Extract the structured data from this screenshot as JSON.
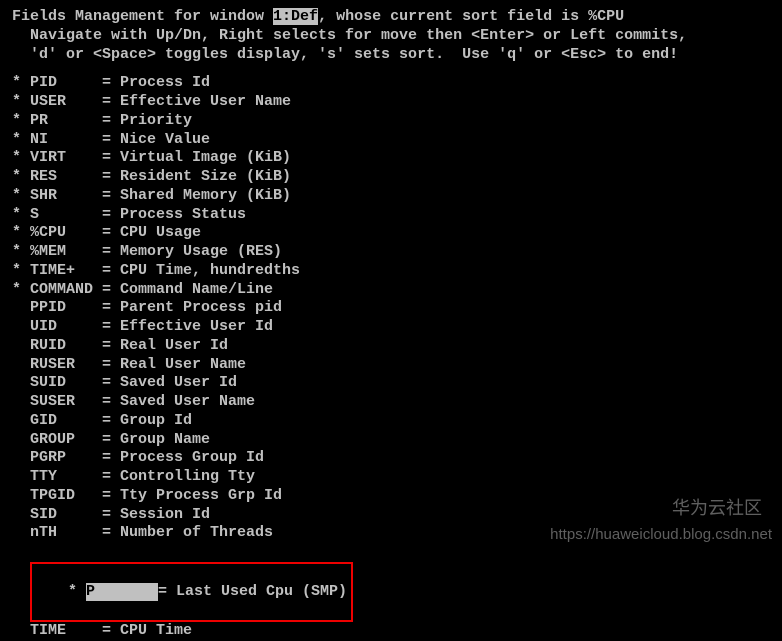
{
  "header": {
    "pre1": "Fields Management for window ",
    "win": "1:Def",
    "post1": ", whose current sort field is %CPU",
    "line2": "Navigate with Up/Dn, Right selects for move then <Enter> or Left commits,",
    "line3": "'d' or <Space> toggles display, 's' sets sort.  Use 'q' or <Esc> to end!"
  },
  "fields": [
    {
      "on": true,
      "name": "PID",
      "desc": "Process Id"
    },
    {
      "on": true,
      "name": "USER",
      "desc": "Effective User Name"
    },
    {
      "on": true,
      "name": "PR",
      "desc": "Priority"
    },
    {
      "on": true,
      "name": "NI",
      "desc": "Nice Value"
    },
    {
      "on": true,
      "name": "VIRT",
      "desc": "Virtual Image (KiB)"
    },
    {
      "on": true,
      "name": "RES",
      "desc": "Resident Size (KiB)"
    },
    {
      "on": true,
      "name": "SHR",
      "desc": "Shared Memory (KiB)"
    },
    {
      "on": true,
      "name": "S",
      "desc": "Process Status"
    },
    {
      "on": true,
      "name": "%CPU",
      "desc": "CPU Usage"
    },
    {
      "on": true,
      "name": "%MEM",
      "desc": "Memory Usage (RES)"
    },
    {
      "on": true,
      "name": "TIME+",
      "desc": "CPU Time, hundredths"
    },
    {
      "on": true,
      "name": "COMMAND",
      "desc": "Command Name/Line"
    },
    {
      "on": false,
      "name": "PPID",
      "desc": "Parent Process pid"
    },
    {
      "on": false,
      "name": "UID",
      "desc": "Effective User Id"
    },
    {
      "on": false,
      "name": "RUID",
      "desc": "Real User Id"
    },
    {
      "on": false,
      "name": "RUSER",
      "desc": "Real User Name"
    },
    {
      "on": false,
      "name": "SUID",
      "desc": "Saved User Id"
    },
    {
      "on": false,
      "name": "SUSER",
      "desc": "Saved User Name"
    },
    {
      "on": false,
      "name": "GID",
      "desc": "Group Id"
    },
    {
      "on": false,
      "name": "GROUP",
      "desc": "Group Name"
    },
    {
      "on": false,
      "name": "PGRP",
      "desc": "Process Group Id"
    },
    {
      "on": false,
      "name": "TTY",
      "desc": "Controlling Tty"
    },
    {
      "on": false,
      "name": "TPGID",
      "desc": "Tty Process Grp Id"
    },
    {
      "on": false,
      "name": "SID",
      "desc": "Session Id"
    },
    {
      "on": false,
      "name": "nTH",
      "desc": "Number of Threads"
    }
  ],
  "highlighted": {
    "on": true,
    "name": "P",
    "desc": "Last Used Cpu (SMP)"
  },
  "after": [
    {
      "on": false,
      "name": "TIME",
      "desc": "CPU Time"
    }
  ],
  "watermark1": "华为云社区",
  "watermark2": "https://huaweicloud.blog.csdn.net"
}
